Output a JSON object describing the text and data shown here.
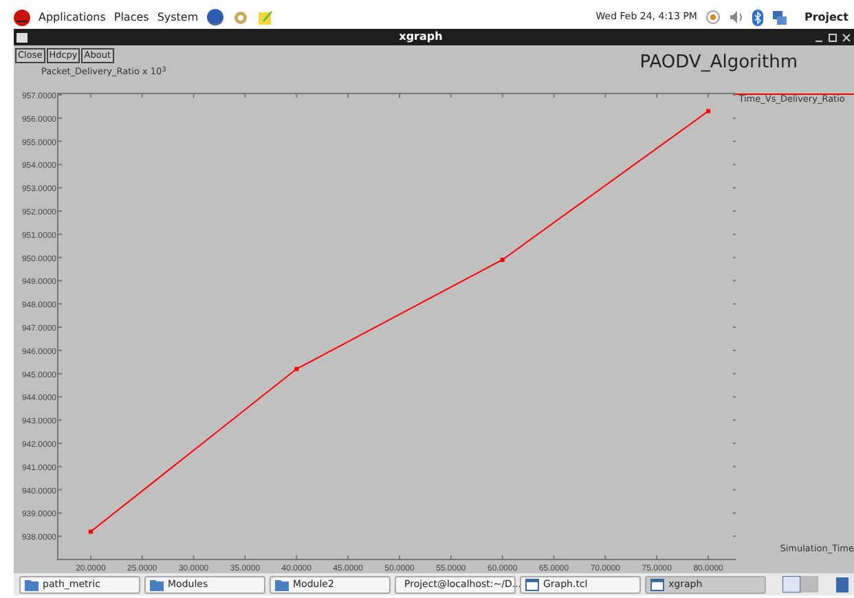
{
  "top_panel": {
    "menus": [
      "Applications",
      "Places",
      "System"
    ],
    "clock": "Wed Feb 24,  4:13 PM",
    "user": "Project"
  },
  "window": {
    "title": "xgraph",
    "buttons": [
      "Close",
      "Hdcpy",
      "About"
    ],
    "graph_title": "PAODV_Algorithm",
    "chart_data": {
      "type": "line",
      "ylabel": "Packet_Delivery_Ratio x 10$^{3}$",
      "xlabel": "Simulation_Time",
      "x": [
        20,
        40,
        60,
        80
      ],
      "xlim": [
        16.8,
        82.8
      ],
      "ylim": [
        937,
        957
      ],
      "xticks": [
        {
          "value": 20,
          "label": "20.0000"
        },
        {
          "value": 25,
          "label": "25.0000"
        },
        {
          "value": 30,
          "label": "30.0000"
        },
        {
          "value": 35,
          "label": "35.0000"
        },
        {
          "value": 40,
          "label": "40.0000"
        },
        {
          "value": 45,
          "label": "45.0000"
        },
        {
          "value": 50,
          "label": "50.0000"
        },
        {
          "value": 55,
          "label": "55.0000"
        },
        {
          "value": 60,
          "label": "60.0000"
        },
        {
          "value": 65,
          "label": "65.0000"
        },
        {
          "value": 70,
          "label": "70.0000"
        },
        {
          "value": 75,
          "label": "75.0000"
        },
        {
          "value": 80,
          "label": "80.0000"
        }
      ],
      "yticks": [
        {
          "value": 957,
          "label": "957.0000"
        },
        {
          "value": 956,
          "label": "956.0000"
        },
        {
          "value": 955,
          "label": "955.0000"
        },
        {
          "value": 954,
          "label": "954.0000"
        },
        {
          "value": 953,
          "label": "953.0000"
        },
        {
          "value": 952,
          "label": "952.0000"
        },
        {
          "value": 951,
          "label": "951.0000"
        },
        {
          "value": 950,
          "label": "950.0000"
        },
        {
          "value": 949,
          "label": "949.0000"
        },
        {
          "value": 948,
          "label": "948.0000"
        },
        {
          "value": 947,
          "label": "947.0000"
        },
        {
          "value": 946,
          "label": "946.0000"
        },
        {
          "value": 945,
          "label": "945.0000"
        },
        {
          "value": 944,
          "label": "944.0000"
        },
        {
          "value": 943,
          "label": "943.0000"
        },
        {
          "value": 942,
          "label": "942.0000"
        },
        {
          "value": 941,
          "label": "941.0000"
        },
        {
          "value": 940,
          "label": "940.0000"
        },
        {
          "value": 939,
          "label": "939.0000"
        },
        {
          "value": 938,
          "label": "938.0000"
        }
      ],
      "series": [
        {
          "name": "Time_Vs_Delivery_Ratio",
          "color": "#ff0000",
          "marker": "square",
          "values": [
            938.2,
            945.2,
            949.9,
            956.3
          ]
        }
      ]
    }
  },
  "taskbar": [
    {
      "label": "path_metric",
      "kind": "folder",
      "selected": false
    },
    {
      "label": "Modules",
      "kind": "folder",
      "selected": false
    },
    {
      "label": "Module2",
      "kind": "folder",
      "selected": false
    },
    {
      "label": "Project@localhost:~/D...",
      "kind": "terminal",
      "selected": false
    },
    {
      "label": "Graph.tcl",
      "kind": "window",
      "selected": false
    },
    {
      "label": "xgraph",
      "kind": "window",
      "selected": true
    }
  ]
}
